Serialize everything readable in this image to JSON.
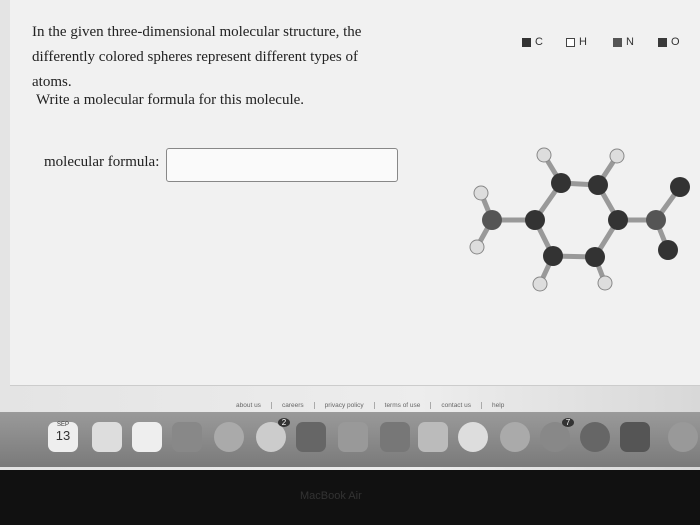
{
  "question": {
    "text": "In the given three-dimensional molecular structure, the differently colored spheres represent different types of atoms.",
    "prompt": "Write a molecular formula for this molecule.",
    "field_label": "molecular formula:",
    "field_value": ""
  },
  "legend": [
    {
      "label": "C",
      "color": "#333333"
    },
    {
      "label": "H",
      "color": "#ffffff"
    },
    {
      "label": "N",
      "color": "#555555"
    },
    {
      "label": "O",
      "color": "#3a3a3a"
    }
  ],
  "footer": [
    "about us",
    "careers",
    "privacy policy",
    "terms of use",
    "contact us",
    "help"
  ],
  "dock": {
    "calendar_month": "SEP",
    "calendar_day": "13",
    "badge_messages": "2",
    "badge_appstore": "7"
  },
  "bezel_label": "MacBook Air"
}
